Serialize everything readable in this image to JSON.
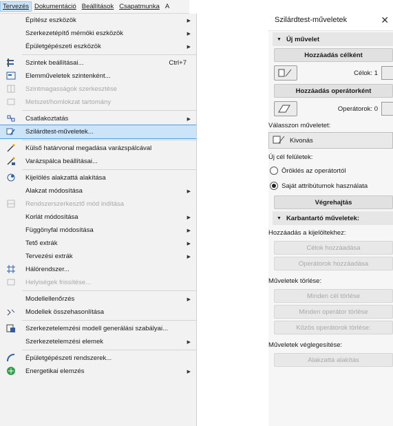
{
  "menubar": {
    "items": [
      "Tervezés",
      "Dokumentáció",
      "Beállítások",
      "Csapatmunka",
      "A"
    ]
  },
  "menu": {
    "items": [
      {
        "label": "Építész eszközök",
        "submenu": true
      },
      {
        "label": "Szerkezetépítő mérnöki eszközök",
        "submenu": true
      },
      {
        "label": "Épületgépészeti eszközök",
        "submenu": true
      },
      {
        "label": "Szintek beállításai...",
        "shortcut": "Ctrl+7",
        "icon": "levels-icon"
      },
      {
        "label": "Elemműveletek szintenként...",
        "icon": "element-ops-icon"
      },
      {
        "label": "Szintmagasságok szerkesztése",
        "disabled": true,
        "icon": "story-height-icon"
      },
      {
        "label": "Metszet/homlokzat tartomány",
        "disabled": true,
        "icon": "section-range-icon"
      },
      {
        "label": "Csatlakoztatás",
        "submenu": true,
        "icon": "connect-icon"
      },
      {
        "label": "Szilárdtest-műveletek...",
        "highlight": true,
        "icon": "solid-ops-icon"
      },
      {
        "label": "Külső határvonal megadása varázspálcával",
        "icon": "magic-wand-icon"
      },
      {
        "label": "Varázspálca beállításai...",
        "icon": "magic-wand-settings-icon"
      },
      {
        "label": "Kijelölés alakzattá alakítása",
        "icon": "morph-icon"
      },
      {
        "label": "Alakzat módosítása",
        "submenu": true
      },
      {
        "label": "Rendszerszerkesztő mód indítása",
        "disabled": true,
        "icon": "system-editor-icon"
      },
      {
        "label": "Korlát módosítása",
        "submenu": true
      },
      {
        "label": "Függönyfal módosítása",
        "submenu": true
      },
      {
        "label": "Tető extrák",
        "submenu": true
      },
      {
        "label": "Tervezési extrák",
        "submenu": true
      },
      {
        "label": "Hálórendszer...",
        "icon": "grid-system-icon"
      },
      {
        "label": "Helyiségek frissítése...",
        "disabled": true,
        "icon": "zones-update-icon"
      },
      {
        "label": "Modellellenőrzés",
        "submenu": true
      },
      {
        "label": "Modellek összehasonlítása",
        "icon": "compare-models-icon"
      },
      {
        "label": "Szerkezetelemzési modell generálási szabályai...",
        "icon": "structural-rules-icon"
      },
      {
        "label": "Szerkezetelemzési elemek",
        "submenu": true
      },
      {
        "label": "Épületgépészeti rendszerek...",
        "icon": "mep-systems-icon"
      },
      {
        "label": "Energetikai elemzés",
        "submenu": true,
        "icon": "energy-icon"
      }
    ]
  },
  "panel": {
    "title": "Szilárdtest-műveletek",
    "new_op_header": "Új művelet",
    "add_target_btn": "Hozzáadás célként",
    "targets_label": "Célok: 1",
    "add_operator_btn": "Hozzáadás operátorként",
    "operators_label": "Operátorok: 0",
    "choose_op_label": "Válasszon műveletet:",
    "op_value": "Kivonás",
    "new_surface_label": "Új cél felületek:",
    "radio1": "Öröklés az operátortól",
    "radio2": "Saját attribútumok használata",
    "execute_btn": "Végrehajtás",
    "maint_header": "Karbantartó műveletek:",
    "add_selection_label": "Hozzáadás a kijelöltekhez:",
    "add_targets_btn": "Célok hozzáadása",
    "add_operators_btn": "Operátorok hozzáadása",
    "delete_label": "Műveletek törlése:",
    "del_all_targets_btn": "Minden cél törlése",
    "del_all_operators_btn": "Minden operátor törlése",
    "del_shared_btn": "Közös operátorok törlése:",
    "finalize_label": "Műveletek véglegesítése:",
    "to_morph_btn": "Alakzattá alakítás"
  }
}
